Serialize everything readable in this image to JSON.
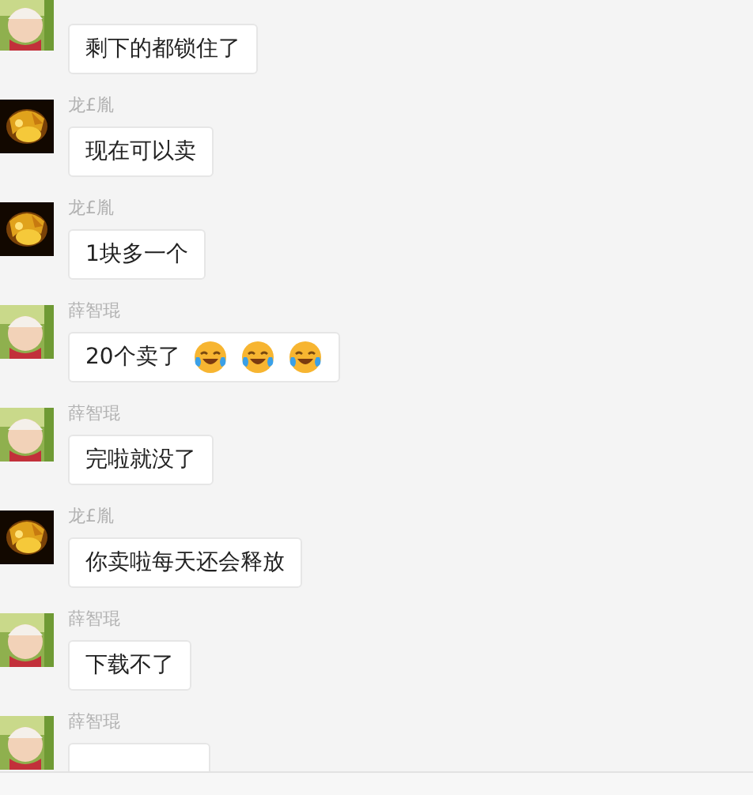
{
  "messages": [
    {
      "avatar": {
        "color": "#8fb04e"
      },
      "content": [
        {
          "kind": "text",
          "text": "剩下的都锁住了"
        }
      ]
    },
    {
      "sender": "龙£胤",
      "avatar": {
        "color": "#120800"
      },
      "content": [
        {
          "kind": "text",
          "text": "现在可以卖"
        }
      ]
    },
    {
      "sender": "龙£胤",
      "avatar": {
        "color": "#120800"
      },
      "content": [
        {
          "kind": "text",
          "text": "1块多一个"
        }
      ]
    },
    {
      "sender": "薛智琨",
      "avatar": {
        "color": "#8fb04e"
      },
      "content": [
        {
          "kind": "text",
          "text": "20个卖了"
        },
        {
          "kind": "emoji"
        },
        {
          "kind": "emoji"
        },
        {
          "kind": "emoji"
        }
      ]
    },
    {
      "sender": "薛智琨",
      "avatar": {
        "color": "#8fb04e"
      },
      "content": [
        {
          "kind": "text",
          "text": "完啦就没了"
        }
      ]
    },
    {
      "sender": "龙£胤",
      "avatar": {
        "color": "#120800"
      },
      "content": [
        {
          "kind": "text",
          "text": "你卖啦每天还会释放"
        }
      ]
    },
    {
      "sender": "薛智琨",
      "avatar": {
        "color": "#8fb04e"
      },
      "content": [
        {
          "kind": "text",
          "text": "下载不了"
        }
      ]
    },
    {
      "sender": "薛智琨",
      "avatar": {
        "color": "#8fb04e"
      }
    }
  ]
}
